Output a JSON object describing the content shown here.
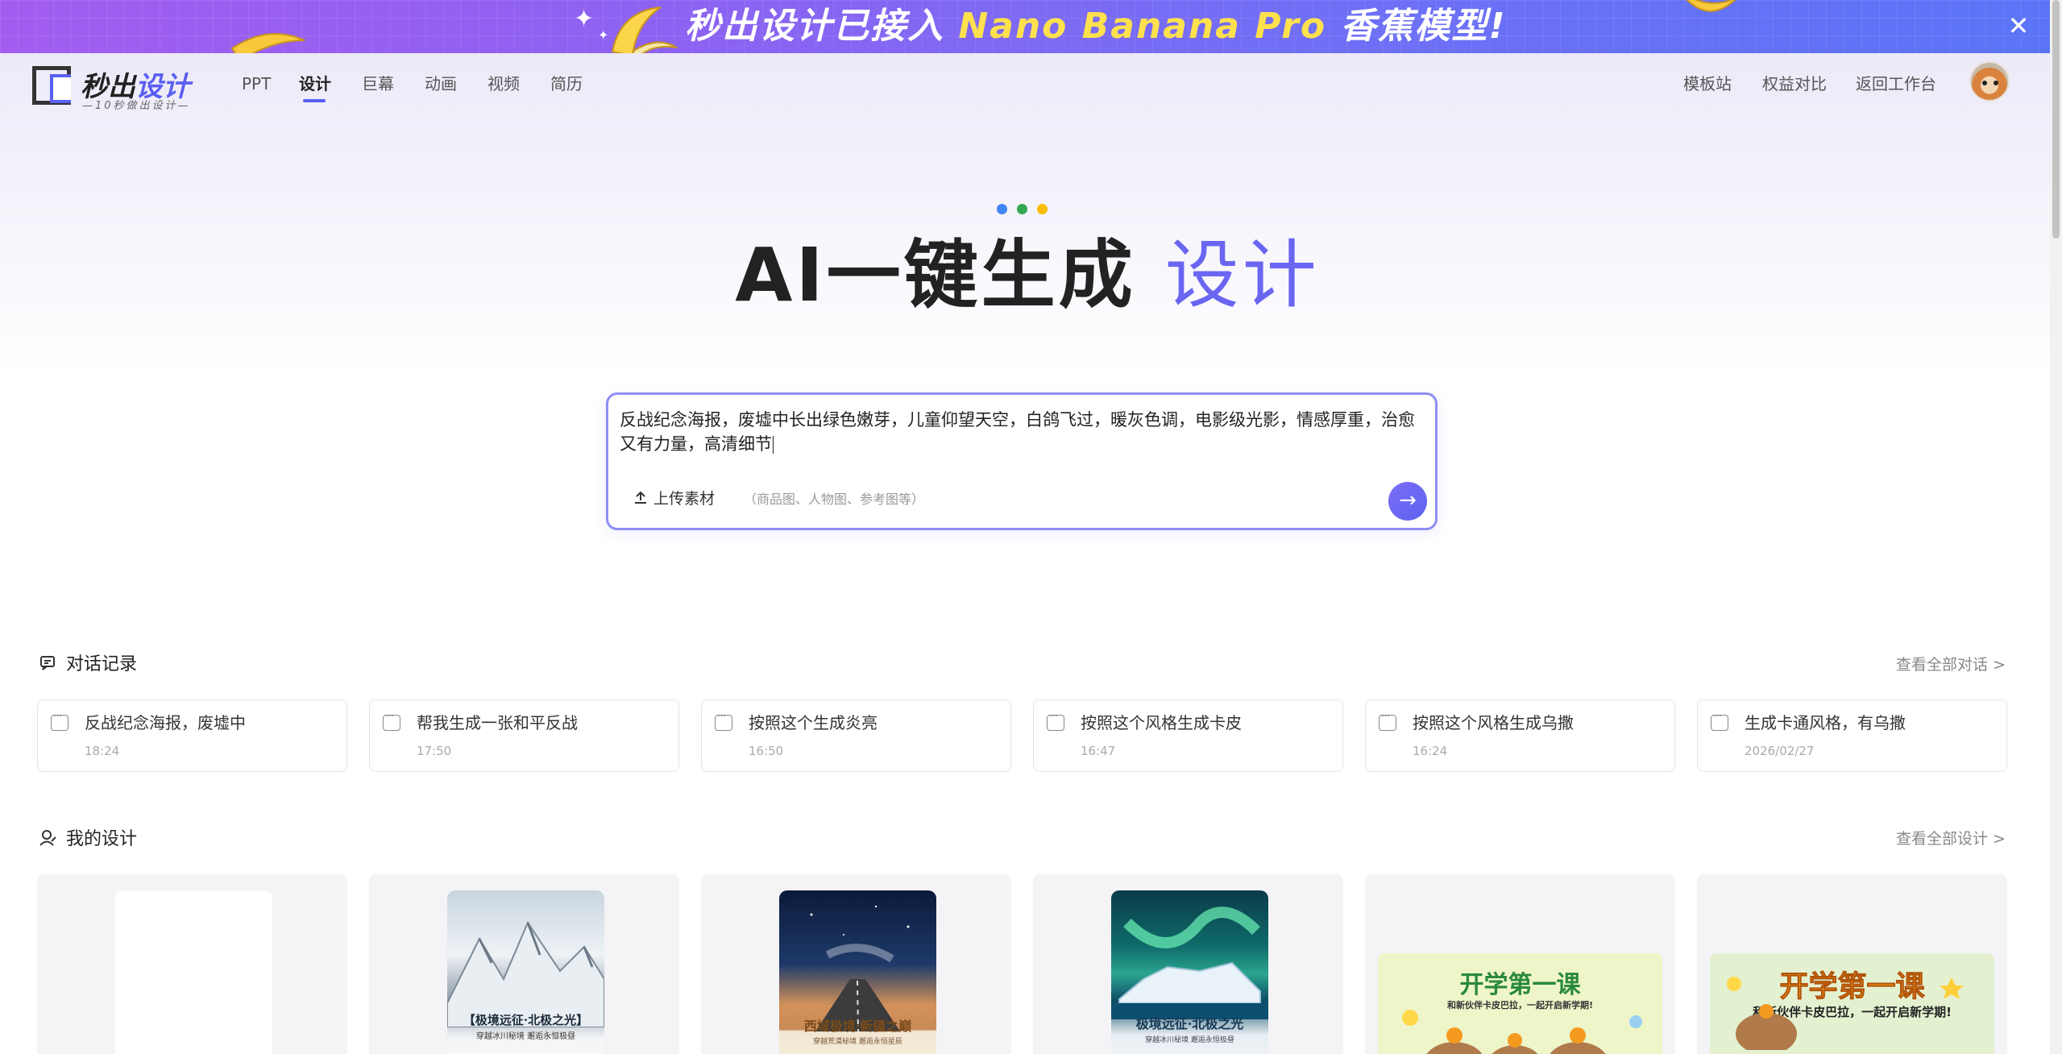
{
  "banner": {
    "text_prefix": "秒出设计已接入",
    "text_highlight": "Nano Banana Pro",
    "text_suffix": "香蕉模型!",
    "close_icon": "close-icon"
  },
  "nav": {
    "logo_name_a": "秒出",
    "logo_name_b": "设计",
    "logo_slogan": "—10秒做出设计—",
    "items": [
      "PPT",
      "设计",
      "巨幕",
      "动画",
      "视频",
      "简历"
    ],
    "active_index": 1,
    "right_links": [
      "模板站",
      "权益对比",
      "返回工作台"
    ]
  },
  "hero": {
    "title_main": "AI一键生成",
    "title_highlight": "设计",
    "dot_colors": [
      "#4285f4",
      "#34a853",
      "#fbbc05"
    ]
  },
  "prompt": {
    "text": "反战纪念海报，废墟中长出绿色嫩芽，儿童仰望天空，白鸽飞过，暖灰色调，电影级光影，情感厚重，治愈又有力量，高清细节",
    "upload_label": "上传素材",
    "upload_hint": "（商品图、人物图、参考图等）"
  },
  "history": {
    "title": "对话记录",
    "view_all": "查看全部对话",
    "items": [
      {
        "title": "反战纪念海报，废墟中",
        "time": "18:24"
      },
      {
        "title": "帮我生成一张和平反战",
        "time": "17:50"
      },
      {
        "title": "按照这个生成炎亮",
        "time": "16:50"
      },
      {
        "title": "按照这个风格生成卡皮",
        "time": "16:47"
      },
      {
        "title": "按照这个风格生成乌撒",
        "time": "16:24"
      },
      {
        "title": "生成卡通风格，有乌撒",
        "time": "2026/02/27"
      }
    ]
  },
  "designs": {
    "title": "我的设计",
    "view_all": "查看全部设计",
    "items": [
      {
        "caption": "",
        "sub": ""
      },
      {
        "caption": "【极境远征·北极之光】",
        "sub": "穿越冰川秘境 邂逅永恒极昼"
      },
      {
        "caption": "西域极境·新疆之巅",
        "sub": "穿越荒漠秘境 邂逅永恒星辰"
      },
      {
        "caption": "极境远征·北极之光",
        "sub": "穿越冰川秘境 邂逅永恒极昼"
      },
      {
        "caption": "开学第一课",
        "sub": "和新伙伴卡皮巴拉，一起开启新学期!"
      },
      {
        "caption": "开学第一课",
        "sub": "和新伙伴卡皮巴拉，一起开启新学期!"
      }
    ]
  }
}
